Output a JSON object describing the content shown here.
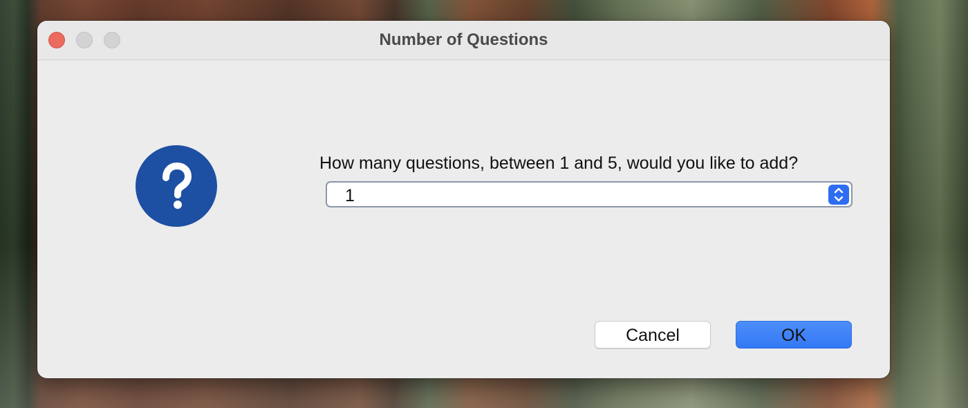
{
  "window": {
    "title": "Number of Questions"
  },
  "dialog": {
    "icon": "question-icon",
    "prompt": "How many questions, between 1 and 5, would you like to add?",
    "selected_value": "1"
  },
  "buttons": {
    "cancel_label": "Cancel",
    "ok_label": "OK"
  },
  "colors": {
    "accent": "#3478f6",
    "icon_background": "#1d4fa3",
    "close_button": "#ec6a5e"
  }
}
